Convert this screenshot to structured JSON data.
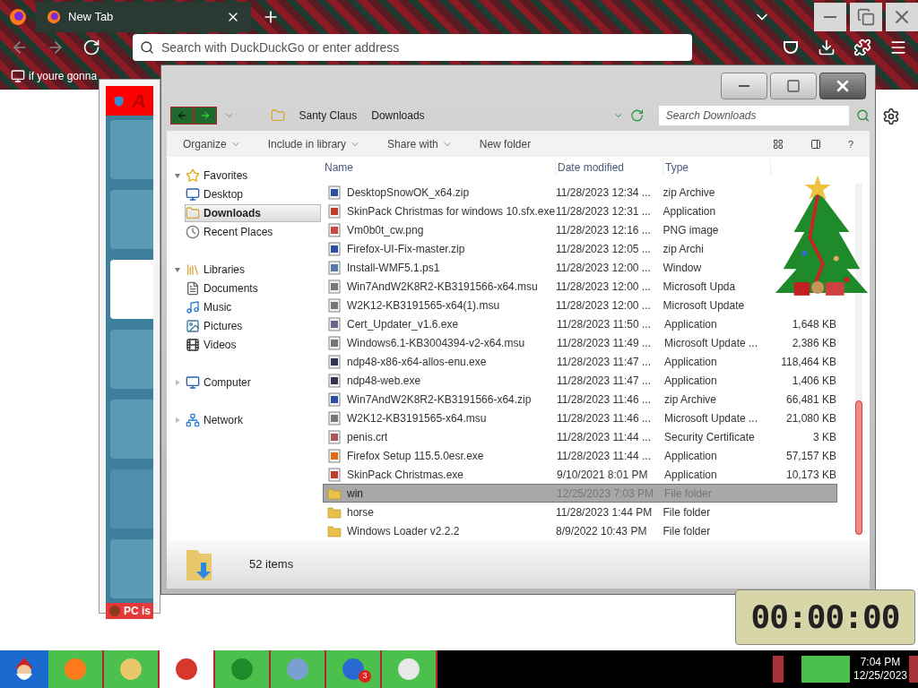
{
  "browser": {
    "tabs": [
      {
        "label": "New Tab",
        "selected": true
      }
    ],
    "address_placeholder": "Search with DuckDuckGo or enter address",
    "bookmarks": [
      "if youre gonna"
    ]
  },
  "background_app": {
    "title": "A",
    "status": "PC is"
  },
  "explorer": {
    "breadcrumb": [
      "Santy Claus",
      "Downloads"
    ],
    "search_placeholder": "Search Downloads",
    "toolbar": [
      {
        "label": "Organize",
        "kind": "menu"
      },
      {
        "label": "Include in library",
        "kind": "menu"
      },
      {
        "label": "Share with",
        "kind": "menu"
      },
      {
        "label": "New folder",
        "kind": "button"
      }
    ],
    "help_label": "?",
    "nav": [
      {
        "label": "Favorites",
        "expanded": true,
        "children": [
          {
            "label": "Desktop",
            "selected": false
          },
          {
            "label": "Downloads",
            "selected": true
          },
          {
            "label": "Recent Places",
            "selected": false
          }
        ]
      },
      {
        "label": "Libraries",
        "expanded": true,
        "children": [
          {
            "label": "Documents",
            "selected": false
          },
          {
            "label": "Music",
            "selected": false
          },
          {
            "label": "Pictures",
            "selected": false
          },
          {
            "label": "Videos",
            "selected": false
          }
        ]
      },
      {
        "label": "Computer",
        "expanded": false
      },
      {
        "label": "Network",
        "expanded": false
      }
    ],
    "columns": [
      "Name",
      "Date modified",
      "Type"
    ],
    "rows": [
      {
        "name": "DesktopSnowOK_x64.zip",
        "date": "11/28/2023 12:34 ...",
        "type": "zip Archive",
        "kind": "zip",
        "selected": false
      },
      {
        "name": "SkinPack Christmas for windows 10.sfx.exe",
        "date": "11/28/2023 12:31 ...",
        "type": "Application",
        "kind": "skin",
        "selected": false
      },
      {
        "name": "Vm0b0t_cw.png",
        "date": "11/28/2023 12:16 ...",
        "type": "PNG image",
        "kind": "image",
        "selected": false
      },
      {
        "name": "Firefox-UI-Fix-master.zip",
        "date": "11/28/2023 12:05 ...",
        "type": "zip Archi",
        "kind": "zip",
        "selected": false
      },
      {
        "name": "Install-WMF5.1.ps1",
        "date": "11/28/2023 12:00 ...",
        "type": "Window",
        "kind": "script",
        "selected": false
      },
      {
        "name": "Win7AndW2K8R2-KB3191566-x64.msu",
        "date": "11/28/2023 12:00 ...",
        "type": "Microsoft Upda",
        "kind": "msu",
        "selected": false
      },
      {
        "name": "W2K12-KB3191565-x64(1).msu",
        "date": "11/28/2023 12:00 ...",
        "type": "Microsoft Update",
        "kind": "msu",
        "selected": false
      },
      {
        "name": "Cert_Updater_v1.6.exe",
        "date": "11/28/2023 11:50 ...",
        "type": "Application",
        "size": "1,648 KB",
        "kind": "exe",
        "selected": false
      },
      {
        "name": "Windows6.1-KB3004394-v2-x64.msu",
        "date": "11/28/2023 11:49 ...",
        "type": "Microsoft Update ...",
        "size": "2,386 KB",
        "kind": "msu",
        "selected": false
      },
      {
        "name": "ndp48-x86-x64-allos-enu.exe",
        "date": "11/28/2023 11:47 ...",
        "type": "Application",
        "size": "118,464 KB",
        "kind": "setup",
        "selected": false
      },
      {
        "name": "ndp48-web.exe",
        "date": "11/28/2023 11:47 ...",
        "type": "Application",
        "size": "1,406 KB",
        "kind": "setup",
        "selected": false
      },
      {
        "name": "Win7AndW2K8R2-KB3191566-x64.zip",
        "date": "11/28/2023 11:46 ...",
        "type": "zip Archive",
        "size": "66,481 KB",
        "kind": "zip",
        "selected": false
      },
      {
        "name": "W2K12-KB3191565-x64.msu",
        "date": "11/28/2023 11:46 ...",
        "type": "Microsoft Update ...",
        "size": "21,080 KB",
        "kind": "msu",
        "selected": false
      },
      {
        "name": "penis.crt",
        "date": "11/28/2023 11:44 ...",
        "type": "Security Certificate",
        "size": "3 KB",
        "kind": "cert",
        "selected": false
      },
      {
        "name": "Firefox Setup 115.5.0esr.exe",
        "date": "11/28/2023 11:44 ...",
        "type": "Application",
        "size": "57,157 KB",
        "kind": "firefox",
        "selected": false
      },
      {
        "name": "SkinPack Christmas.exe",
        "date": "9/10/2021 8:01 PM",
        "type": "Application",
        "size": "10,173 KB",
        "kind": "skin",
        "selected": false
      },
      {
        "name": "win",
        "date": "12/25/2023 7:03 PM",
        "type": "File folder",
        "kind": "folder",
        "selected": true
      },
      {
        "name": "horse",
        "date": "11/28/2023 1:44 PM",
        "type": "File folder",
        "kind": "folder",
        "selected": false
      },
      {
        "name": "Windows Loader v2.2.2",
        "date": "8/9/2022 10:43 PM",
        "type": "File folder",
        "kind": "folder",
        "selected": false
      }
    ],
    "item_count": "52 items"
  },
  "timer": "00:00:00",
  "taskbar": {
    "apps": [
      {
        "kind": "firefox",
        "selected": false
      },
      {
        "kind": "explorer",
        "selected": false
      },
      {
        "kind": "chrome",
        "selected": true
      },
      {
        "kind": "tree",
        "selected": false
      },
      {
        "kind": "photos",
        "selected": false
      },
      {
        "kind": "messenger",
        "badge": "3",
        "selected": false
      },
      {
        "kind": "shield",
        "selected": false
      }
    ],
    "time": "7:04 PM",
    "date": "12/25/2023"
  }
}
